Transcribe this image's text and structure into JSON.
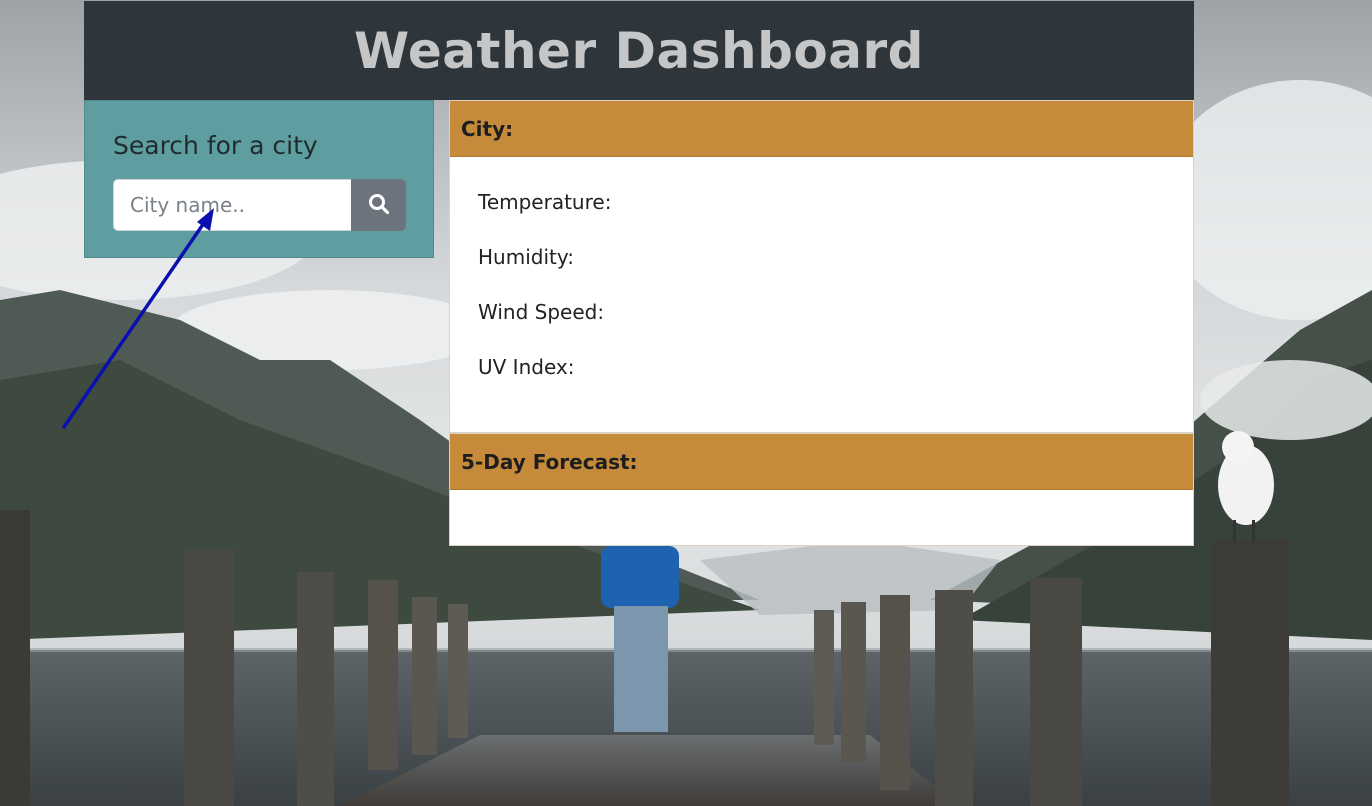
{
  "header": {
    "title": "Weather Dashboard"
  },
  "search": {
    "heading": "Search for a city",
    "placeholder": "City name..",
    "value": "",
    "button_icon": "search-icon"
  },
  "current": {
    "header_label": "City:",
    "stats": [
      {
        "label": "Temperature:",
        "value": ""
      },
      {
        "label": "Humidity:",
        "value": ""
      },
      {
        "label": "Wind Speed:",
        "value": ""
      },
      {
        "label": "UV Index:",
        "value": ""
      }
    ]
  },
  "forecast": {
    "header_label": "5-Day Forecast:"
  },
  "colors": {
    "header_bg": "#2e353b",
    "header_text": "#c4c6c8",
    "search_panel_bg": "#5f9ea0",
    "card_header_bg": "#c68b3a",
    "search_button_bg": "#6c757d",
    "annotation_arrow": "#0a10b0"
  }
}
